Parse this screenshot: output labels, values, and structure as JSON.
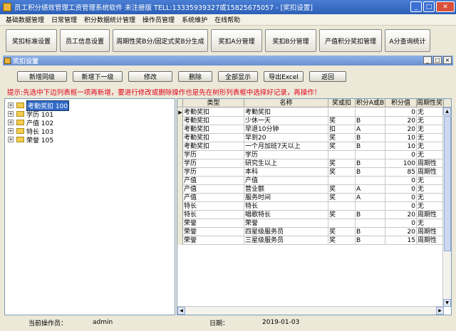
{
  "window": {
    "title": "员工积分绩效管理工资管理系统软件 未注册版 TELL:13335939327或15825675057 - [奖扣设置]",
    "min": "_",
    "max": "□",
    "close": "✕"
  },
  "menu": [
    "基础数据管理",
    "日常管理",
    "积分数据统计管理",
    "操作员管理",
    "系统维护",
    "在线帮助"
  ],
  "toolbar": [
    "奖扣标准设置",
    "员工信息设置",
    "周期性奖B分/固定式奖B分生成",
    "奖扣A分管理",
    "奖扣B分管理",
    "产值积分奖扣管理",
    "A分查询统计"
  ],
  "subwindow": {
    "title": "奖扣设置",
    "btn_min": "_",
    "btn_max": "□",
    "btn_close": "×"
  },
  "actions": [
    "新增同级",
    "新增下一级",
    "修改",
    "删除",
    "全部显示",
    "导出Excel",
    "返回"
  ],
  "hint": "提示:先选中下边列表框一项再新增，要进行修改或删除操作也是先在树形列表框中选择好记录，再操作！",
  "tree": [
    {
      "label": "考勤奖扣 100",
      "selected": true
    },
    {
      "label": "学历 101",
      "selected": false
    },
    {
      "label": "产值 102",
      "selected": false
    },
    {
      "label": "特长 103",
      "selected": false
    },
    {
      "label": "荣誉 105",
      "selected": false
    }
  ],
  "grid": {
    "columns": [
      "类型",
      "名称",
      "奖或扣",
      "积分A或B",
      "积分值",
      "周期性奖扣"
    ],
    "rows": [
      [
        "考勤奖扣",
        "考勤奖扣",
        "",
        "",
        "0",
        "无"
      ],
      [
        "考勤奖扣",
        "少休一天",
        "奖",
        "B",
        "20",
        "无"
      ],
      [
        "考勤奖扣",
        "早退10分钟",
        "扣",
        "A",
        "20",
        "无"
      ],
      [
        "考勤奖扣",
        "早到20",
        "奖",
        "B",
        "10",
        "无"
      ],
      [
        "考勤奖扣",
        "一个月加班7天以上",
        "奖",
        "B",
        "10",
        "无"
      ],
      [
        "学历",
        "学历",
        "",
        "",
        "0",
        "无"
      ],
      [
        "学历",
        "研究生以上",
        "奖",
        "B",
        "100",
        "周期性"
      ],
      [
        "学历",
        "本科",
        "奖",
        "B",
        "85",
        "周期性"
      ],
      [
        "产值",
        "产值",
        "",
        "",
        "0",
        "无"
      ],
      [
        "产值",
        "营业额",
        "奖",
        "A",
        "0",
        "无"
      ],
      [
        "产值",
        "服务时间",
        "奖",
        "A",
        "0",
        "无"
      ],
      [
        "特长",
        "特长",
        "",
        "",
        "0",
        "无"
      ],
      [
        "特长",
        "唱歌特长",
        "奖",
        "B",
        "20",
        "周期性"
      ],
      [
        "荣誉",
        "荣誉",
        "",
        "",
        "0",
        "无"
      ],
      [
        "荣誉",
        "四星级服务员",
        "奖",
        "B",
        "20",
        "周期性"
      ],
      [
        "荣誉",
        "三星级服务员",
        "奖",
        "B",
        "15",
        "周期性"
      ]
    ]
  },
  "status": {
    "operator_label": "当前操作员：",
    "operator": "admin",
    "date_label": "日期：",
    "date": "2019-01-03"
  }
}
